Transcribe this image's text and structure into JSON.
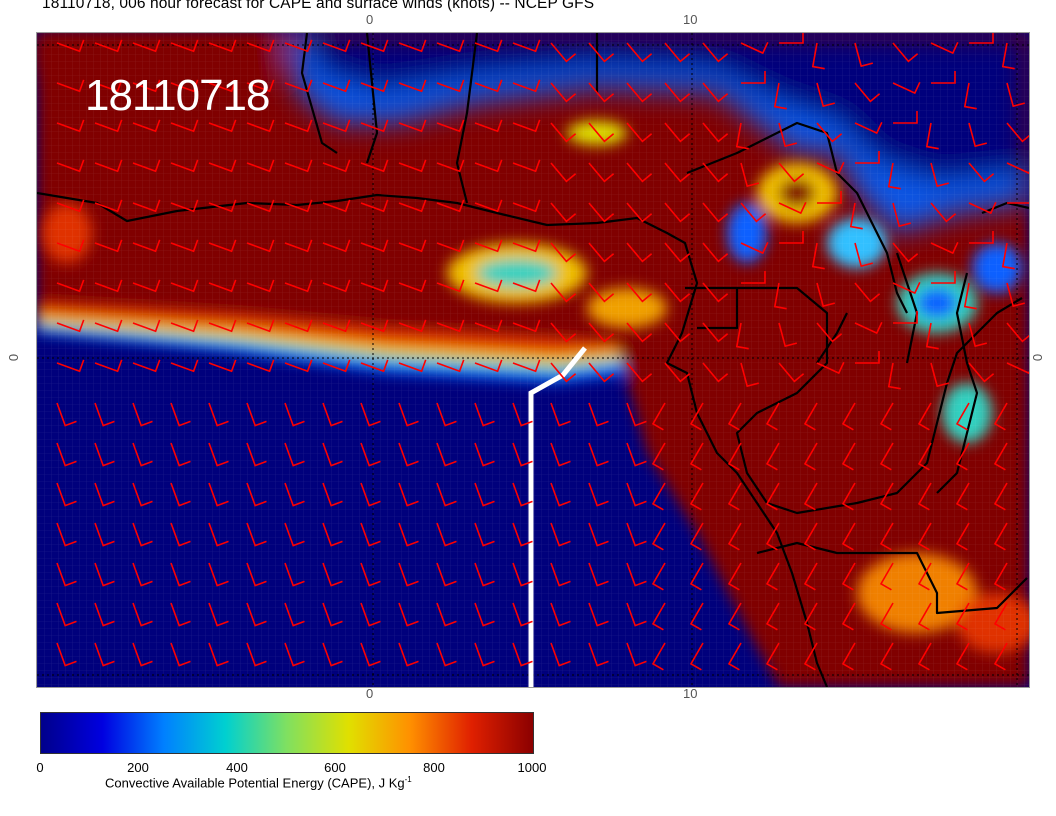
{
  "title": "18110718, 006 hour forecast for CAPE and surface winds (knots) -- NCEP GFS",
  "timestamp": "18110718",
  "axis_ticks": {
    "top": [
      "0",
      "10"
    ],
    "bottom": [
      "0",
      "10"
    ],
    "left": "0",
    "right": "0"
  },
  "colorbar": {
    "ticks": [
      "0",
      "200",
      "400",
      "600",
      "800",
      "1000"
    ],
    "label": "Convective Available Potential Energy (CAPE), J Kg",
    "label_unit_exponent": "-1",
    "colors": [
      "#00008b",
      "#0000e0",
      "#0080ff",
      "#00d0d0",
      "#80e060",
      "#e0e000",
      "#ff9000",
      "#e02000",
      "#8b0000"
    ]
  },
  "colors": {
    "land_high_cape": "#800000",
    "ocean_low_cape": "#00007c",
    "wind_barbs": "#ff0000",
    "coastline": "#000000",
    "flight_track": "#ffffff"
  }
}
